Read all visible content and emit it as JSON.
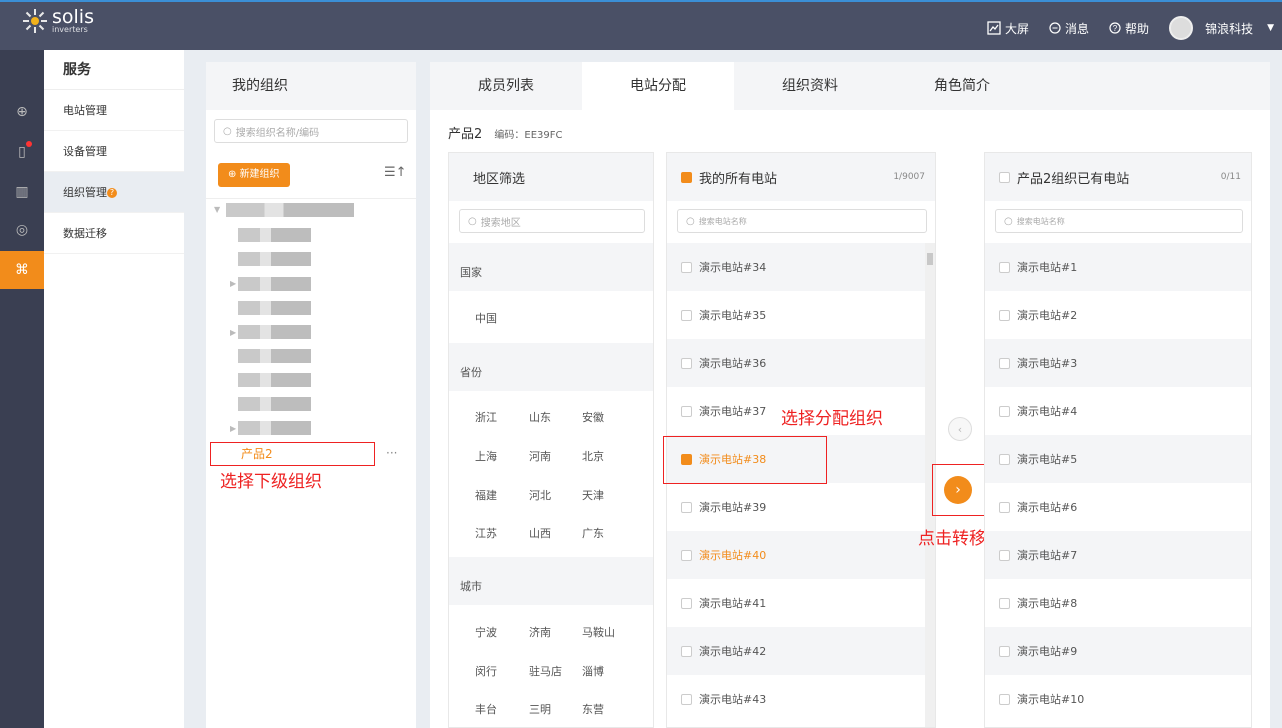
{
  "topbar": {
    "logo": "solis",
    "logo_sub": "inverters",
    "big_screen": "大屏",
    "messages": "消息",
    "help": "帮助",
    "company": "锦浪科技"
  },
  "menu": {
    "title": "服务",
    "items": [
      "电站管理",
      "设备管理",
      "组织管理",
      "数据迁移"
    ],
    "badge": "?"
  },
  "org": {
    "title": "我的组织",
    "search_placeholder": "搜索组织名称/编码",
    "new_button": "新建组织",
    "selected": "产品2",
    "more": "···"
  },
  "tabs": [
    "成员列表",
    "电站分配",
    "组织资料",
    "角色简介"
  ],
  "info": {
    "name": "产品2",
    "code_label": "编码：",
    "code": "EE39FC"
  },
  "region": {
    "title": "地区筛选",
    "search_placeholder": "搜索地区",
    "country_label": "国家",
    "countries": [
      "中国"
    ],
    "province_label": "省份",
    "provinces": [
      [
        "浙江",
        "山东",
        "安徽"
      ],
      [
        "上海",
        "河南",
        "北京"
      ],
      [
        "福建",
        "河北",
        "天津"
      ],
      [
        "江苏",
        "山西",
        "广东"
      ]
    ],
    "city_label": "城市",
    "cities": [
      [
        "宁波",
        "济南",
        "马鞍山"
      ],
      [
        "闵行",
        "驻马店",
        "淄博"
      ],
      [
        "丰台",
        "三明",
        "东营"
      ]
    ]
  },
  "stations": {
    "title": "我的所有电站",
    "count": "1/9007",
    "search_placeholder": "搜索电站名称",
    "items": [
      "演示电站#34",
      "演示电站#35",
      "演示电站#36",
      "演示电站#37",
      "演示电站#38",
      "演示电站#39",
      "演示电站#40",
      "演示电站#41",
      "演示电站#42",
      "演示电站#43"
    ]
  },
  "target": {
    "title": "产品2组织已有电站",
    "count": "0/11",
    "search_placeholder": "搜索电站名称",
    "items": [
      "演示电站#1",
      "演示电站#2",
      "演示电站#3",
      "演示电站#4",
      "演示电站#5",
      "演示电站#6",
      "演示电站#7",
      "演示电站#8",
      "演示电站#9",
      "演示电站#10"
    ]
  },
  "annotations": {
    "select_org": "选择下级组织",
    "select_station": "选择分配组织",
    "click_transfer": "点击转移"
  },
  "colors": {
    "accent": "#f28c1b",
    "annotation": "#e22222",
    "topbar": "#4a5066"
  }
}
